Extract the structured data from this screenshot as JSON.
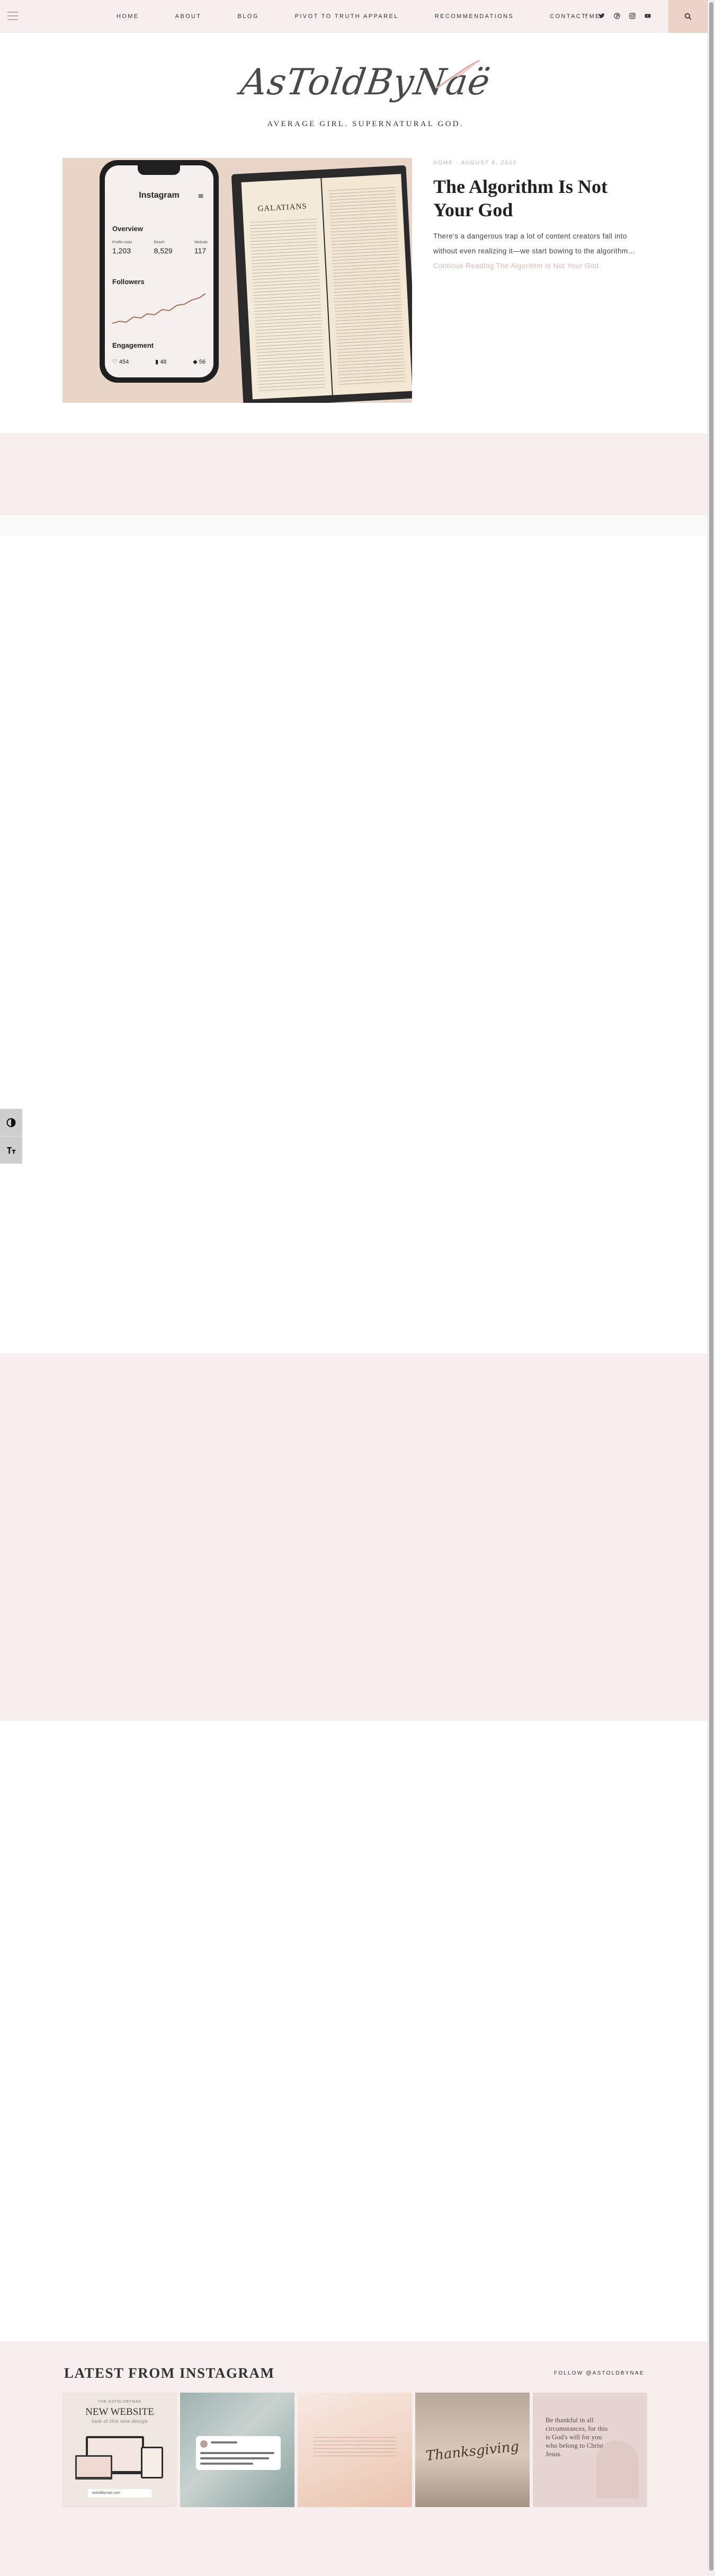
{
  "nav": {
    "items": [
      "Home",
      "About",
      "Blog",
      "Pivot To Truth Apparel",
      "Recommendations",
      "Contact Me"
    ],
    "social_icons": [
      {
        "name": "facebook-icon",
        "glyph": "f"
      },
      {
        "name": "twitter-icon",
        "glyph": "🐦"
      },
      {
        "name": "pinterest-icon",
        "glyph": "℗"
      },
      {
        "name": "instagram-icon",
        "glyph": "◎"
      },
      {
        "name": "youtube-icon",
        "glyph": "▶"
      }
    ]
  },
  "site": {
    "logo_text": "AsToldByNaë",
    "tagline": "Average Girl. Supernatural God."
  },
  "featured": {
    "meta": "Home · August 8, 2023",
    "title": "The Algorithm Is Not Your God",
    "excerpt": "There’s a dangerous trap a lot of content creators fall into without even realizing it—we start bowing to the algorithm…",
    "read_more": "Continue Reading The Algorithm Is Not Your God",
    "image": {
      "phone_app": "Instagram",
      "overview": "Overview",
      "stats": [
        {
          "label": "Profile visits",
          "value": "1,203"
        },
        {
          "label": "Reach",
          "value": "8,529"
        },
        {
          "label": "Website",
          "value": "117"
        }
      ],
      "followers": "Followers",
      "engagement": "Engagement",
      "engagement_counts": [
        "454",
        "48",
        "56"
      ],
      "bible_book": "GALATIANS"
    }
  },
  "instagram": {
    "heading": "Latest From Instagram",
    "follow": "Follow @astoldbynae",
    "tiles": [
      {
        "headline": "NEW WEBSITE",
        "kicker": "THE ASTOLDBYNAE",
        "sub": "look at this new design",
        "search": "astoldbynae.com"
      },
      {
        "kind": "tweet"
      },
      {
        "kind": "quote"
      },
      {
        "script": "Thanksgiving"
      },
      {
        "text": "Be thankful in all circumstances, for this is God's will for you who belong to Christ Jesus."
      }
    ]
  },
  "colors": {
    "accent": "#ecd3ca",
    "band": "#f7eeee",
    "link_muted": "#d8b9b0"
  }
}
